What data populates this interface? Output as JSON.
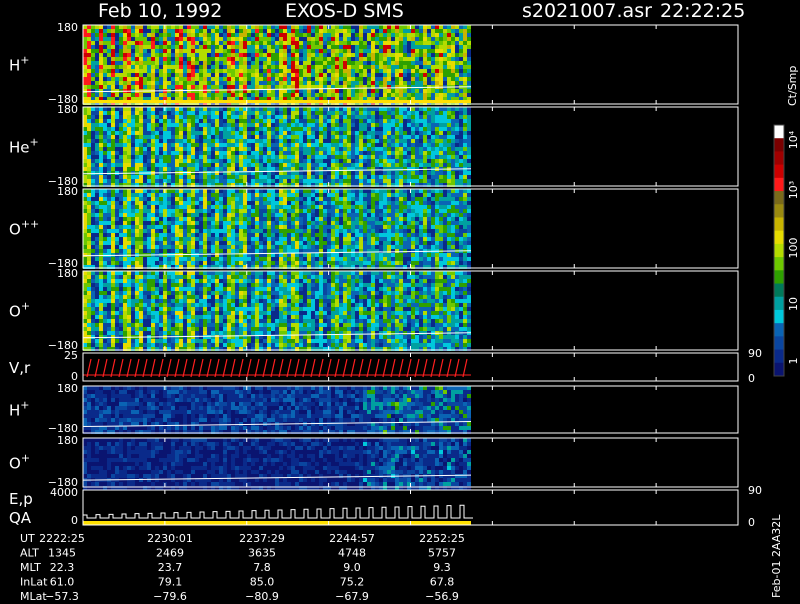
{
  "header": {
    "date": "Feb 10, 1992",
    "mission": "EXOS-D SMS",
    "file": "s2021007.asr",
    "time": "22:22:25"
  },
  "panels": [
    {
      "label": "H",
      "sup": "+",
      "top_tick": "180",
      "bottom_tick": "−180",
      "kind": "spec",
      "intensity": "high"
    },
    {
      "label": "He",
      "sup": "+",
      "top_tick": "180",
      "bottom_tick": "−180",
      "kind": "spec",
      "intensity": "mid"
    },
    {
      "label": "O",
      "sup": "++",
      "top_tick": "180",
      "bottom_tick": "−180",
      "kind": "spec",
      "intensity": "mid"
    },
    {
      "label": "O",
      "sup": "+",
      "top_tick": "180",
      "bottom_tick": "−180",
      "kind": "spec",
      "intensity": "mid"
    },
    {
      "label": "V,r",
      "sup": "",
      "top_tick": "25",
      "bottom_tick": "0",
      "right_top": "90",
      "right_bottom": "0",
      "kind": "line"
    },
    {
      "label": "H",
      "sup": "+",
      "top_tick": "180",
      "bottom_tick": "−180",
      "kind": "spec",
      "intensity": "low"
    },
    {
      "label": "O",
      "sup": "+",
      "top_tick": "180",
      "bottom_tick": "−180",
      "kind": "spec",
      "intensity": "vlow"
    },
    {
      "label": "E,p",
      "label2": "QA",
      "sup": "",
      "top_tick": "4000",
      "bottom_tick": "0",
      "right_top": "90",
      "right_bottom": "0",
      "kind": "steps"
    }
  ],
  "colorbar": {
    "unit": "Ct/Smp",
    "tick_labels": [
      "10⁴",
      "10³",
      "100",
      "10",
      "1"
    ],
    "colors": [
      "#ffffff",
      "#7a0000",
      "#a00000",
      "#cc0000",
      "#ff1a1a",
      "#7a6a1a",
      "#9a8a10",
      "#c8b400",
      "#e6dc00",
      "#b4dc00",
      "#6ec800",
      "#2ea000",
      "#007a5a",
      "#00a0a0",
      "#00c8dc",
      "#0a64b4",
      "#0a46a0",
      "#0a2a8a",
      "#0a1470"
    ]
  },
  "footer": {
    "rows": [
      {
        "label": "UT",
        "values": [
          "2222:25",
          "2230:01",
          "2237:29",
          "2244:57",
          "2252:25"
        ]
      },
      {
        "label": "ALT",
        "values": [
          "1345",
          "2469",
          "3635",
          "4748",
          "5757"
        ]
      },
      {
        "label": "MLT",
        "values": [
          "22.3",
          "23.7",
          "7.8",
          "9.0",
          "9.3"
        ]
      },
      {
        "label": "InLat",
        "values": [
          "61.0",
          "79.1",
          "85.0",
          "75.2",
          "67.8"
        ]
      },
      {
        "label": "MLat",
        "values": [
          "−57.3",
          "−79.6",
          "−80.9",
          "−67.9",
          "−56.9"
        ]
      }
    ],
    "side_label": "Feb-01 2AA32L"
  },
  "chart_data": {
    "type": "heatmap",
    "title": "Feb 10, 1992   EXOS-D SMS",
    "xlabel": "UT",
    "x_ticks": [
      "2222:25",
      "2230:01",
      "2237:29",
      "2244:57",
      "2252:25"
    ],
    "ylim": [
      -180,
      180
    ],
    "colorbar_label": "Ct/Smp",
    "colorbar_ticks": [
      "1",
      "10",
      "100",
      "10³",
      "10⁴"
    ],
    "series": [
      {
        "name": "H+",
        "ylim": [
          -180,
          180
        ]
      },
      {
        "name": "He+",
        "ylim": [
          -180,
          180
        ]
      },
      {
        "name": "O++",
        "ylim": [
          -180,
          180
        ]
      },
      {
        "name": "O+",
        "ylim": [
          -180,
          180
        ]
      },
      {
        "name": "V,r",
        "ylim": [
          0,
          25
        ],
        "right_ylim": [
          0,
          90
        ]
      },
      {
        "name": "H+",
        "ylim": [
          -180,
          180
        ]
      },
      {
        "name": "O+",
        "ylim": [
          -180,
          180
        ]
      },
      {
        "name": "E,p",
        "ylim": [
          0,
          4000
        ],
        "right_ylim": [
          0,
          90
        ]
      }
    ]
  }
}
